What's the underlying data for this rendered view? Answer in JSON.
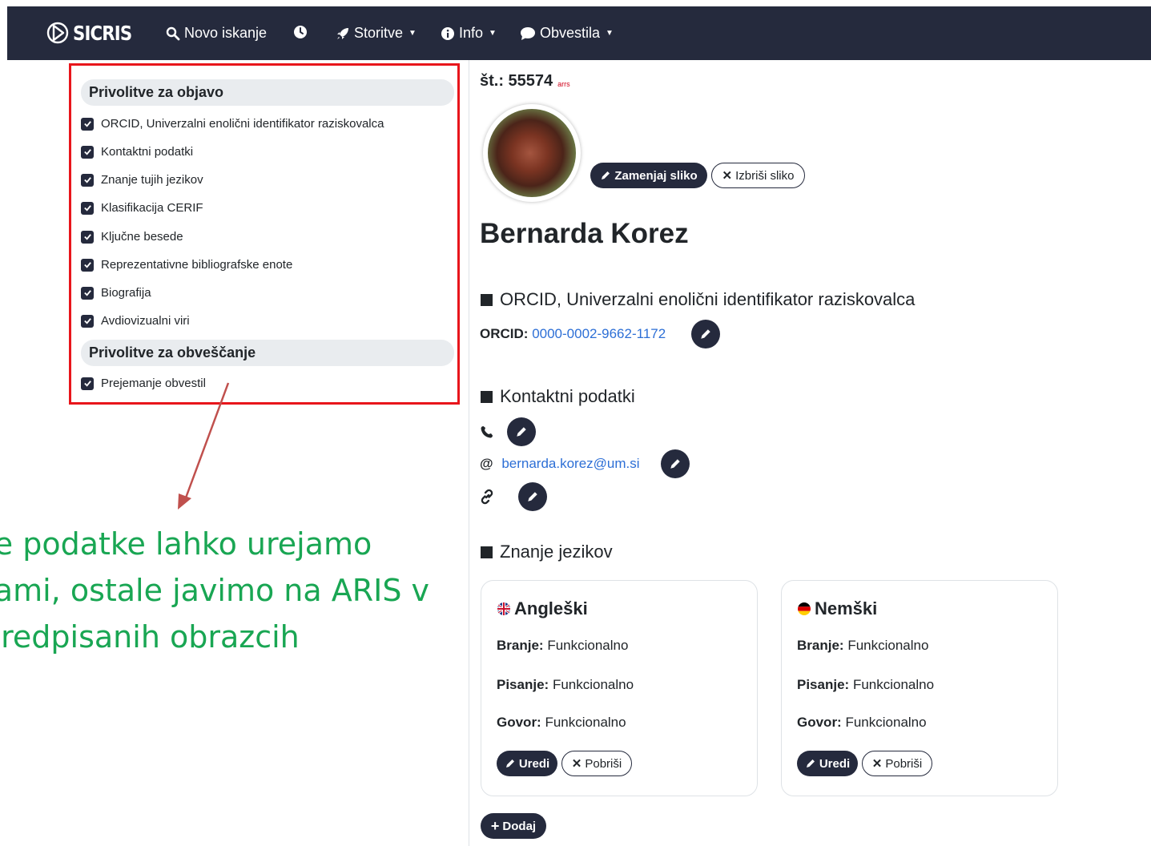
{
  "nav": {
    "brand": "SICRIS",
    "search": "Novo iskanje",
    "services": "Storitve",
    "info": "Info",
    "notices": "Obvestila"
  },
  "consents": {
    "publish_title": "Privolitve za objavo",
    "publish_items": [
      "ORCID, Univerzalni enolični identifikator raziskovalca",
      "Kontaktni podatki",
      "Znanje tujih jezikov",
      "Klasifikacija CERIF",
      "Ključne besede",
      "Reprezentativne bibliografske enote",
      "Biografija",
      "Avdiovizualni viri"
    ],
    "notify_title": "Privolitve za obveščanje",
    "notify_items": [
      "Prejemanje obvestil"
    ]
  },
  "annotation": {
    "line1": "Te podatke lahko urejamo",
    "line2": "sami, ostale javimo na ARIS v",
    "line3": "predpisanih obrazcih"
  },
  "profile": {
    "number_label": "št.: 55574",
    "arrs_logo": "arrs",
    "replace_photo": "Zamenjaj sliko",
    "delete_photo": "Izbriši sliko",
    "name": "Bernarda Korez",
    "orcid_section": "ORCID, Univerzalni enolični identifikator raziskovalca",
    "orcid_label": "ORCID:",
    "orcid_value": "0000-0002-9662-1172",
    "contact_section": "Kontaktni podatki",
    "email_symbol": "@",
    "email": "bernarda.korez@um.si",
    "languages_section": "Znanje jezikov",
    "languages": [
      {
        "name": "Angleški",
        "reading_label": "Branje:",
        "reading": "Funkcionalno",
        "writing_label": "Pisanje:",
        "writing": "Funkcionalno",
        "speaking_label": "Govor:",
        "speaking": "Funkcionalno"
      },
      {
        "name": "Nemški",
        "reading_label": "Branje:",
        "reading": "Funkcionalno",
        "writing_label": "Pisanje:",
        "writing": "Funkcionalno",
        "speaking_label": "Govor:",
        "speaking": "Funkcionalno"
      }
    ],
    "edit_label": "Uredi",
    "delete_label": "Pobriši",
    "add_label": "Dodaj"
  },
  "colors": {
    "navbar": "#252a3d",
    "highlight": "#e8151b",
    "annotation": "#19a653",
    "link": "#2d6fd6"
  }
}
